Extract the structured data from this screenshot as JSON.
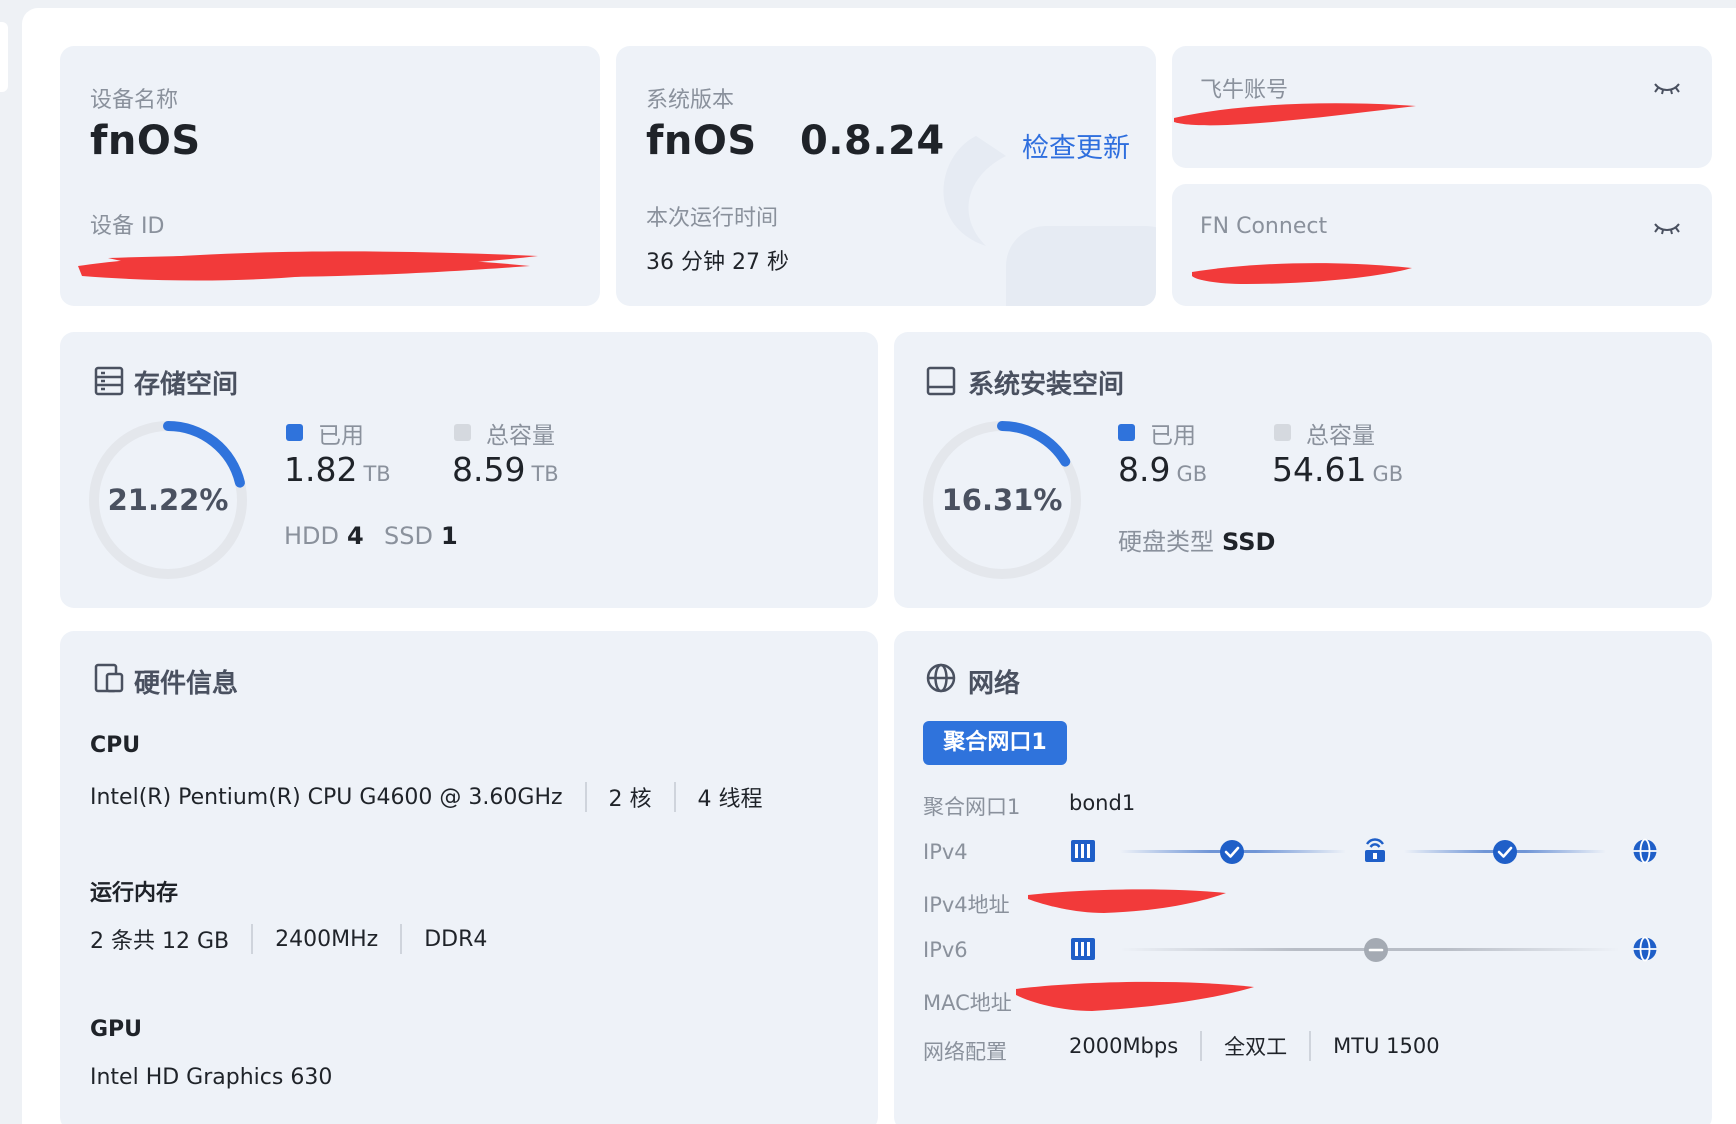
{
  "device": {
    "name_label": "设备名称",
    "name_value": "fnOS",
    "id_label": "设备 ID"
  },
  "system": {
    "version_label": "系统版本",
    "version_value": "fnOS   0.8.24",
    "check_update": "检查更新",
    "uptime_label": "本次运行时间",
    "uptime_value": "36 分钟 27 秒"
  },
  "account": {
    "label": "飞牛账号"
  },
  "fnconnect": {
    "label": "FN Connect"
  },
  "storage": {
    "title": "存储空间",
    "percent_text": "21.22%",
    "used_fraction": 0.2122,
    "used_label": "已用",
    "used_value": "1.82",
    "used_unit": "TB",
    "total_label": "总容量",
    "total_value": "8.59",
    "total_unit": "TB",
    "hdd_label": "HDD",
    "hdd_count": "4",
    "ssd_label": "SSD",
    "ssd_count": "1"
  },
  "system_space": {
    "title": "系统安装空间",
    "percent_text": "16.31%",
    "used_fraction": 0.1631,
    "used_label": "已用",
    "used_value": "8.9",
    "used_unit": "GB",
    "total_label": "总容量",
    "total_value": "54.61",
    "total_unit": "GB",
    "disk_type_label": "硬盘类型",
    "disk_type_value": "SSD"
  },
  "hardware": {
    "title": "硬件信息",
    "cpu_heading": "CPU",
    "cpu_model": "Intel(R) Pentium(R) CPU G4600 @ 3.60GHz",
    "cpu_cores": "2 核",
    "cpu_threads": "4 线程",
    "mem_heading": "运行内存",
    "mem_size": "2 条共 12 GB",
    "mem_speed": "2400MHz",
    "mem_type": "DDR4",
    "gpu_heading": "GPU",
    "gpu_model": "Intel HD Graphics 630"
  },
  "network": {
    "title": "网络",
    "bond_tab": "聚合网口1",
    "bond_label": "聚合网口1",
    "bond_value": "bond1",
    "ipv4_label": "IPv4",
    "ipv4_addr_label": "IPv4地址",
    "ipv6_label": "IPv6",
    "mac_label": "MAC地址",
    "config_label": "网络配置",
    "speed": "2000Mbps",
    "duplex": "全双工",
    "mtu": "MTU 1500"
  },
  "colors": {
    "accent": "#2f73dc",
    "used": "#2f73dc",
    "total": "#d5d9df",
    "redaction": "#f23a3a"
  }
}
